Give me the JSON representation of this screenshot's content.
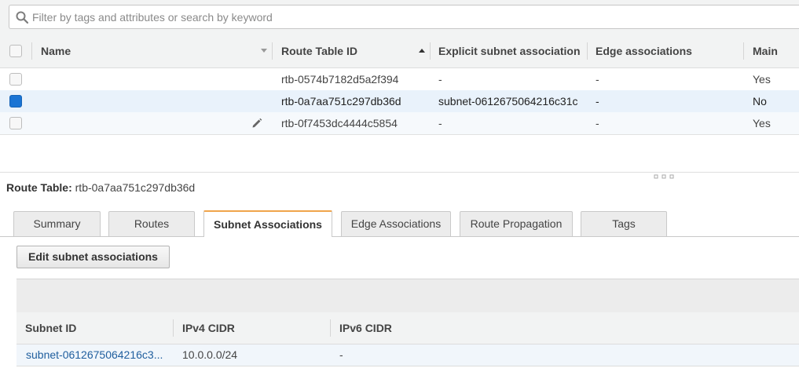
{
  "search": {
    "placeholder": "Filter by tags and attributes or search by keyword"
  },
  "route_table": {
    "columns": [
      "Name",
      "Route Table ID",
      "Explicit subnet association",
      "Edge associations",
      "Main"
    ],
    "rows": [
      {
        "name": "",
        "id": "rtb-0574b7182d5a2f394",
        "explicit": "-",
        "edge": "-",
        "main": "Yes",
        "selected": false
      },
      {
        "name": "",
        "id": "rtb-0a7aa751c297db36d",
        "explicit": "subnet-0612675064216c31c",
        "edge": "-",
        "main": "No",
        "selected": true
      },
      {
        "name": "",
        "id": "rtb-0f7453dc4444c5854",
        "explicit": "-",
        "edge": "-",
        "main": "Yes",
        "selected": false
      }
    ]
  },
  "detail": {
    "title_label": "Route Table:",
    "title_value": "rtb-0a7aa751c297db36d",
    "tabs": [
      "Summary",
      "Routes",
      "Subnet Associations",
      "Edge Associations",
      "Route Propagation",
      "Tags"
    ],
    "active_tab": "Subnet Associations",
    "edit_button": "Edit subnet associations",
    "subnet_columns": [
      "Subnet ID",
      "IPv4 CIDR",
      "IPv6 CIDR"
    ],
    "subnet_rows": [
      {
        "subnet_id": "subnet-0612675064216c3...",
        "ipv4": "10.0.0.0/24",
        "ipv6": "-"
      }
    ]
  },
  "colors": {
    "accent_tab": "#f0a44b",
    "checkbox_selected": "#1a74d4",
    "link": "#1f5e9e"
  }
}
